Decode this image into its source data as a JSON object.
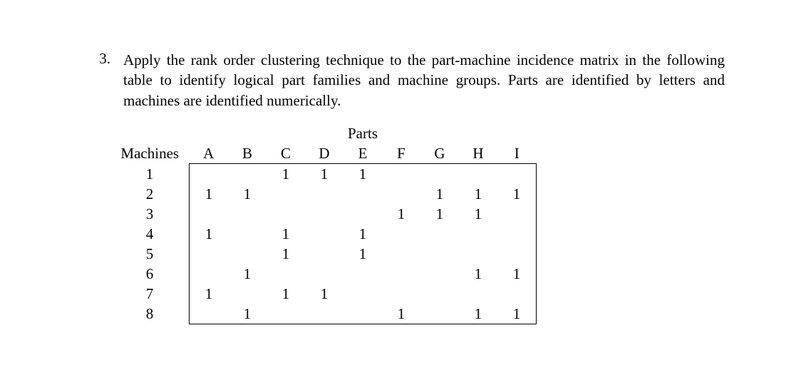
{
  "problem": {
    "number": "3.",
    "text": "Apply the rank order clustering technique to the part-machine incidence matrix in the following table to identify logical part families and machine groups. Parts are identified by letters and machines are identified numerically."
  },
  "table": {
    "parts_label": "Parts",
    "machines_label": "Machines",
    "parts": [
      "A",
      "B",
      "C",
      "D",
      "E",
      "F",
      "G",
      "H",
      "I"
    ],
    "machines": [
      "1",
      "2",
      "3",
      "4",
      "5",
      "6",
      "7",
      "8"
    ],
    "matrix": [
      [
        "",
        "",
        "1",
        "1",
        "1",
        "",
        "",
        "",
        ""
      ],
      [
        "1",
        "1",
        "",
        "",
        "",
        "",
        "1",
        "1",
        "1"
      ],
      [
        "",
        "",
        "",
        "",
        "",
        "1",
        "1",
        "1",
        ""
      ],
      [
        "1",
        "",
        "1",
        "",
        "1",
        "",
        "",
        "",
        ""
      ],
      [
        "",
        "",
        "1",
        "",
        "1",
        "",
        "",
        "",
        ""
      ],
      [
        "",
        "1",
        "",
        "",
        "",
        "",
        "",
        "1",
        "1"
      ],
      [
        "1",
        "",
        "1",
        "1",
        "",
        "",
        "",
        "",
        ""
      ],
      [
        "",
        "1",
        "",
        "",
        "",
        "1",
        "",
        "1",
        "1"
      ]
    ]
  },
  "chart_data": {
    "type": "table",
    "title": "Part-Machine Incidence Matrix",
    "row_header": "Machines",
    "col_header": "Parts",
    "columns": [
      "A",
      "B",
      "C",
      "D",
      "E",
      "F",
      "G",
      "H",
      "I"
    ],
    "rows": [
      "1",
      "2",
      "3",
      "4",
      "5",
      "6",
      "7",
      "8"
    ],
    "data": [
      [
        0,
        0,
        1,
        1,
        1,
        0,
        0,
        0,
        0
      ],
      [
        1,
        1,
        0,
        0,
        0,
        0,
        1,
        1,
        1
      ],
      [
        0,
        0,
        0,
        0,
        0,
        1,
        1,
        1,
        0
      ],
      [
        1,
        0,
        1,
        0,
        1,
        0,
        0,
        0,
        0
      ],
      [
        0,
        0,
        1,
        0,
        1,
        0,
        0,
        0,
        0
      ],
      [
        0,
        1,
        0,
        0,
        0,
        0,
        0,
        1,
        1
      ],
      [
        1,
        0,
        1,
        1,
        0,
        0,
        0,
        0,
        0
      ],
      [
        0,
        1,
        0,
        0,
        0,
        1,
        0,
        1,
        1
      ]
    ]
  }
}
